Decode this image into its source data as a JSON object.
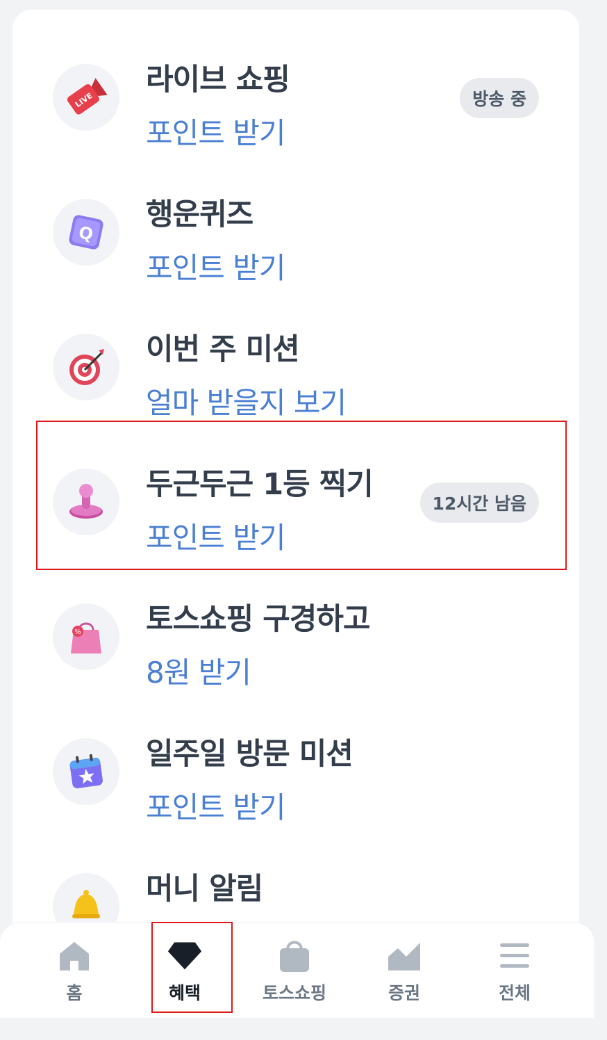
{
  "items": [
    {
      "title": "라이브 쇼핑",
      "action": "포인트 받기",
      "badge": "방송 중",
      "icon": "live-camera-icon"
    },
    {
      "title": "행운퀴즈",
      "action": "포인트 받기",
      "badge": "",
      "icon": "quiz-q-icon"
    },
    {
      "title": "이번 주 미션",
      "action": "얼마 받을지 보기",
      "badge": "",
      "icon": "target-icon"
    },
    {
      "title": "두근두근 1등 찍기",
      "action": "포인트 받기",
      "badge": "12시간 남음",
      "icon": "stamp-icon"
    },
    {
      "title": "토스쇼핑 구경하고",
      "action": "8원 받기",
      "badge": "",
      "icon": "shopping-bag-icon"
    },
    {
      "title": "일주일 방문 미션",
      "action": "포인트 받기",
      "badge": "",
      "icon": "calendar-star-icon"
    },
    {
      "title": "머니 알림",
      "action": "",
      "badge": "",
      "icon": "bell-icon"
    }
  ],
  "nav": [
    {
      "label": "홈",
      "icon": "home-icon",
      "active": false
    },
    {
      "label": "혜택",
      "icon": "benefit-diamond-icon",
      "active": true
    },
    {
      "label": "토스쇼핑",
      "icon": "shopping-bag-icon",
      "active": false
    },
    {
      "label": "증권",
      "icon": "stock-chart-icon",
      "active": false
    },
    {
      "label": "전체",
      "icon": "menu-icon",
      "active": false
    }
  ],
  "colors": {
    "accent": "#4a7fd4",
    "title": "#333d4b",
    "highlight": "#e01818"
  }
}
